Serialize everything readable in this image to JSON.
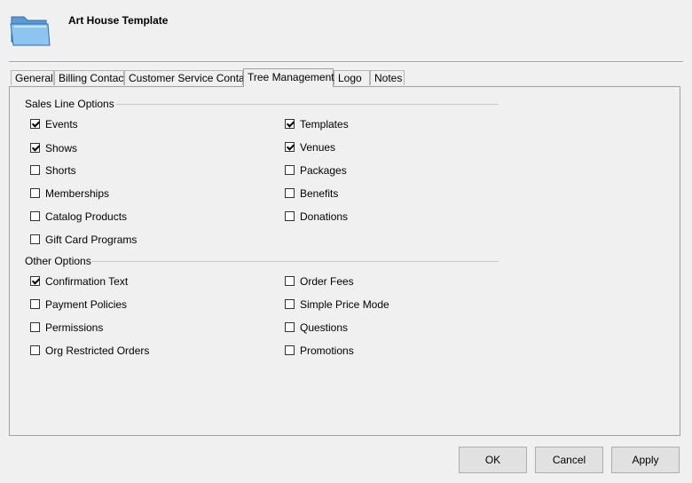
{
  "header": {
    "title": "Art House Template"
  },
  "tabs": [
    {
      "label": "General",
      "active": false
    },
    {
      "label": "Billing Contact",
      "active": false
    },
    {
      "label": "Customer Service Contact",
      "active": false
    },
    {
      "label": "Tree Management",
      "active": true
    },
    {
      "label": "Logo",
      "active": false
    },
    {
      "label": "Notes",
      "active": false
    }
  ],
  "sales_line_options": {
    "title": "Sales Line Options",
    "left": [
      {
        "label": "Events",
        "checked": true
      },
      {
        "label": "Shows",
        "checked": true
      },
      {
        "label": "Shorts",
        "checked": false
      },
      {
        "label": "Memberships",
        "checked": false
      },
      {
        "label": "Catalog Products",
        "checked": false
      },
      {
        "label": "Gift Card Programs",
        "checked": false
      }
    ],
    "right": [
      {
        "label": "Templates",
        "checked": true
      },
      {
        "label": "Venues",
        "checked": true
      },
      {
        "label": "Packages",
        "checked": false
      },
      {
        "label": "Benefits",
        "checked": false
      },
      {
        "label": "Donations",
        "checked": false
      }
    ]
  },
  "other_options": {
    "title": "Other Options",
    "left": [
      {
        "label": "Confirmation Text",
        "checked": true
      },
      {
        "label": "Payment Policies",
        "checked": false
      },
      {
        "label": "Permissions",
        "checked": false
      },
      {
        "label": "Org Restricted Orders",
        "checked": false
      }
    ],
    "right": [
      {
        "label": "Order Fees",
        "checked": false
      },
      {
        "label": "Simple Price Mode",
        "checked": false
      },
      {
        "label": "Questions",
        "checked": false
      },
      {
        "label": "Promotions",
        "checked": false
      }
    ]
  },
  "buttons": {
    "ok": "OK",
    "cancel": "Cancel",
    "apply": "Apply"
  }
}
